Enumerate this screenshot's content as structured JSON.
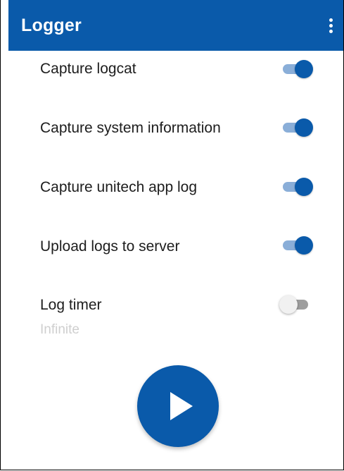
{
  "appbar": {
    "title": "Logger",
    "menu_icon": "more-vert-icon",
    "color": "#0a5aaa"
  },
  "settings": [
    {
      "label": "Capture logcat",
      "enabled": true
    },
    {
      "label": "Capture system information",
      "enabled": true
    },
    {
      "label": "Capture unitech app log",
      "enabled": true
    },
    {
      "label": "Upload logs to server",
      "enabled": true
    },
    {
      "label": "Log timer",
      "sublabel": "Infinite",
      "enabled": false
    }
  ],
  "start_button": {
    "icon": "play-icon",
    "color": "#0a5aaa"
  }
}
